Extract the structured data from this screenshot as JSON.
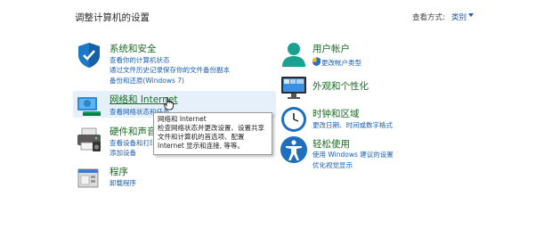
{
  "page": {
    "title": "调整计算机的设置",
    "view_by_label": "查看方式:",
    "view_by_value": "类别"
  },
  "left": {
    "system_security": {
      "icon": "shield-icon",
      "title": "系统和安全",
      "links": [
        "查看你的计算机状态",
        "通过文件历史记录保存你的文件备份副本",
        "备份和还原(Windows 7)"
      ]
    },
    "network": {
      "icon": "network-icon",
      "title": "网络和 Internet",
      "links": [
        "查看网络状态和任务"
      ]
    },
    "hardware": {
      "icon": "printer-icon",
      "title": "硬件和声音",
      "links": [
        "查看设备和打印机",
        "添加设备"
      ]
    },
    "programs": {
      "icon": "programs-icon",
      "title": "程序",
      "links": [
        "卸载程序"
      ]
    }
  },
  "right": {
    "user_accounts": {
      "icon": "user-icon",
      "title": "用户帐户",
      "links": [
        "更改帐户类型"
      ]
    },
    "appearance": {
      "icon": "monitor-icon",
      "title": "外观和个性化"
    },
    "clock_region": {
      "icon": "clock-icon",
      "title": "时钟和区域",
      "links": [
        "更改日期、时间或数字格式"
      ]
    },
    "ease_of_access": {
      "icon": "accessibility-icon",
      "title": "轻松使用",
      "links": [
        "使用 Windows 建议的设置",
        "优化视觉显示"
      ]
    }
  },
  "tooltip": {
    "title": "网络和 Internet",
    "lines": [
      "检查网络状态并更改设置、设置共享",
      "文件和计算机的首选项、配置",
      "Internet 显示和连接, 等等。"
    ]
  },
  "colors": {
    "title_green": "#1a6a24",
    "link_blue": "#1a5fb4",
    "hover_bg": "#e6f0fa"
  }
}
